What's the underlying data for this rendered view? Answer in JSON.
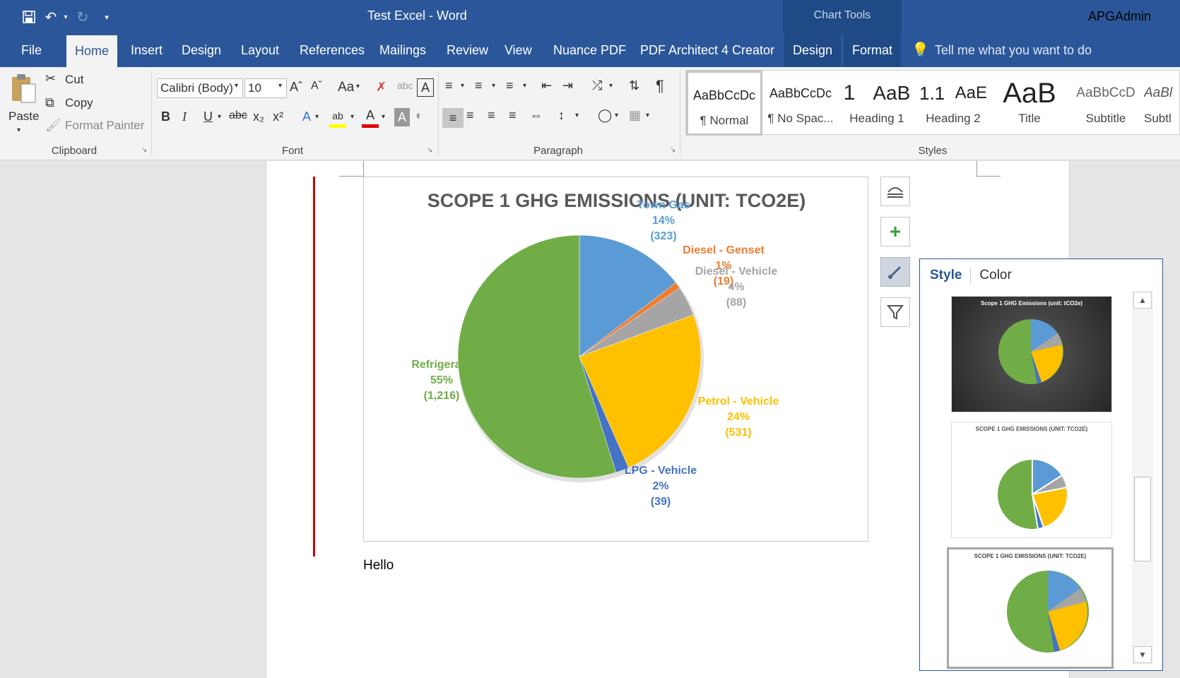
{
  "window": {
    "title": "Test Excel  -  Word",
    "contextual_label": "Chart Tools",
    "user": "APGAdmin"
  },
  "tabs": [
    {
      "label": "File"
    },
    {
      "label": "Home",
      "active": true
    },
    {
      "label": "Insert"
    },
    {
      "label": "Design"
    },
    {
      "label": "Layout"
    },
    {
      "label": "References"
    },
    {
      "label": "Mailings"
    },
    {
      "label": "Review"
    },
    {
      "label": "View"
    },
    {
      "label": "Nuance PDF"
    },
    {
      "label": "PDF Architect 4 Creator"
    },
    {
      "label": "Design"
    },
    {
      "label": "Format"
    }
  ],
  "tell_me": "Tell me what you want to do",
  "clipboard": {
    "paste": "Paste",
    "cut": "Cut",
    "copy": "Copy",
    "format_painter": "Format Painter",
    "group": "Clipboard"
  },
  "font": {
    "name": "Calibri (Body)",
    "size": "10",
    "group": "Font",
    "case_label": "Aa"
  },
  "paragraph": {
    "group": "Paragraph"
  },
  "styles": {
    "group": "Styles",
    "items": [
      {
        "preview": "AaBbCcDc",
        "name": "¶ Normal"
      },
      {
        "preview": "AaBbCcDc",
        "name": "¶ No Spac..."
      },
      {
        "preview": "1",
        "name": "Heading 1"
      },
      {
        "preview": "AaB",
        "name": ""
      },
      {
        "preview": "1.1",
        "name": "Heading 2"
      },
      {
        "preview": "AaE",
        "name": ""
      },
      {
        "preview": "AaB",
        "name": "Title"
      },
      {
        "preview": "AaBbCcD",
        "name": "Subtitle"
      },
      {
        "preview": "AaBl",
        "name": "Subtl"
      }
    ]
  },
  "document": {
    "body_text": "Hello"
  },
  "chart_data": {
    "type": "pie",
    "title": "SCOPE 1 GHG EMISSIONS (UNIT: TCO2E)",
    "slices": [
      {
        "name": "Town Gas",
        "percent": "14%",
        "value": 323,
        "value_label": "(323)",
        "color": "#5b9bd5"
      },
      {
        "name": "Diesel - Genset",
        "percent": "1%",
        "value": 19,
        "value_label": "(19)",
        "color": "#ed7d31"
      },
      {
        "name": "Diesel - Vehicle",
        "percent": "4%",
        "value": 88,
        "value_label": "(88)",
        "color": "#a5a5a5"
      },
      {
        "name": "Petrol - Vehicle",
        "percent": "24%",
        "value": 531,
        "value_label": "(531)",
        "color": "#ffc000"
      },
      {
        "name": "LPG - Vehicle",
        "percent": "2%",
        "value": 39,
        "value_label": "(39)",
        "color": "#4472c4"
      },
      {
        "name": "Refrigerant",
        "percent": "55%",
        "value": 1216,
        "value_label": "(1,216)",
        "color": "#70ad47"
      }
    ]
  },
  "style_pane": {
    "tabs": [
      "Style",
      "Color"
    ],
    "thumb_title_1": "Scope 1 GHG Emissions (unit: tCO2e)",
    "thumb_title_2": "SCOPE 1 GHG EMISSIONS (UNIT: TCO2E)",
    "thumb_title_3": "SCOPE 1 GHG EMISSIONS (UNIT: TCO2E)"
  }
}
